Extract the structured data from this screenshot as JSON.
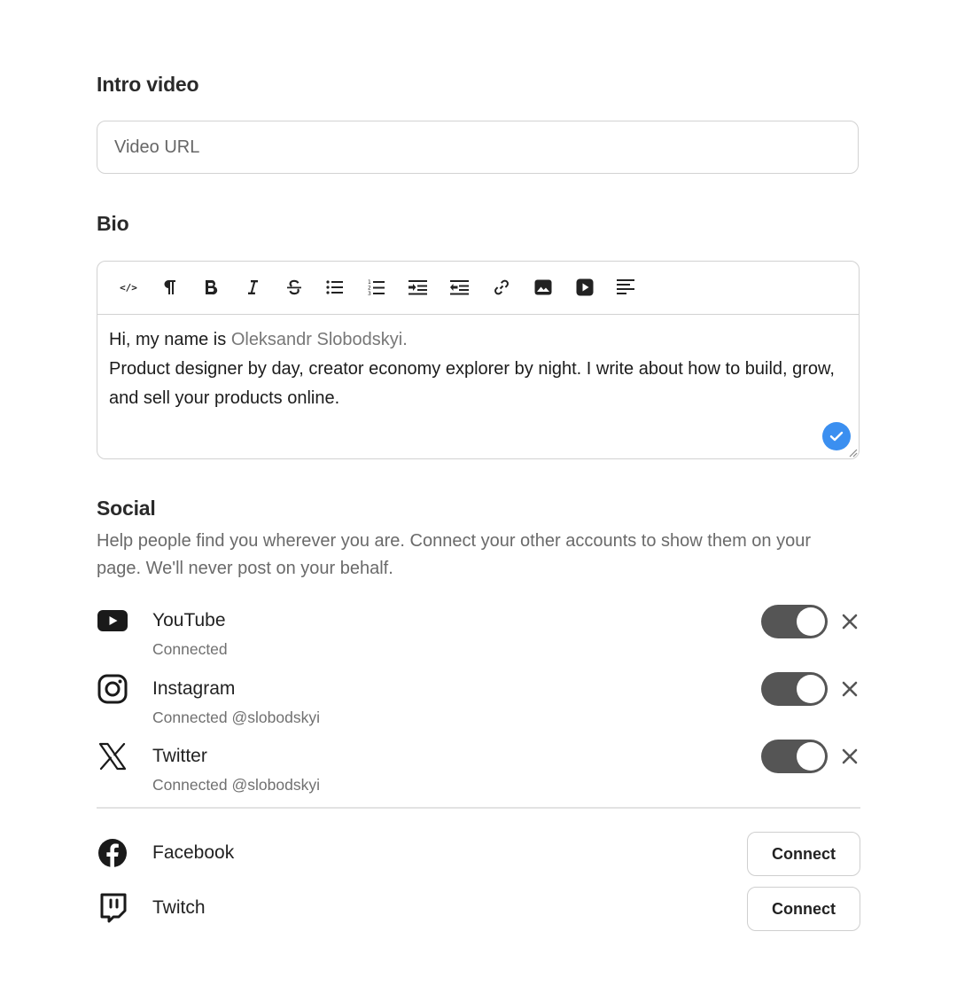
{
  "intro_video": {
    "title": "Intro video",
    "placeholder": "Video URL",
    "value": ""
  },
  "bio": {
    "title": "Bio",
    "toolbar": [
      {
        "name": "code-icon"
      },
      {
        "name": "paragraph-icon"
      },
      {
        "name": "bold-icon"
      },
      {
        "name": "italic-icon"
      },
      {
        "name": "strikethrough-icon"
      },
      {
        "name": "bullet-list-icon"
      },
      {
        "name": "numbered-list-icon"
      },
      {
        "name": "indent-icon"
      },
      {
        "name": "outdent-icon"
      },
      {
        "name": "link-icon"
      },
      {
        "name": "image-icon"
      },
      {
        "name": "video-icon"
      },
      {
        "name": "align-left-icon"
      }
    ],
    "line1_prefix": "Hi, my name is ",
    "line1_name": "Oleksandr Slobodskyi.",
    "line2": "Product designer by day, creator economy explorer by night. I write about how to build, grow, and sell your products online."
  },
  "social": {
    "title": "Social",
    "description": "Help people find you wherever you are. Connect your other accounts to show them on your page. We'll never post on your behalf.",
    "connected": [
      {
        "name": "YouTube",
        "status": "Connected",
        "icon": "youtube-icon",
        "enabled": true
      },
      {
        "name": "Instagram",
        "status": "Connected @slobodskyi",
        "icon": "instagram-icon",
        "enabled": true
      },
      {
        "name": "Twitter",
        "status": "Connected @slobodskyi",
        "icon": "x-twitter-icon",
        "enabled": true
      }
    ],
    "available": [
      {
        "name": "Facebook",
        "icon": "facebook-icon",
        "button": "Connect"
      },
      {
        "name": "Twitch",
        "icon": "twitch-icon",
        "button": "Connect"
      }
    ]
  },
  "colors": {
    "toggle_on": "#555555",
    "check_badge": "#3b8ff0"
  }
}
